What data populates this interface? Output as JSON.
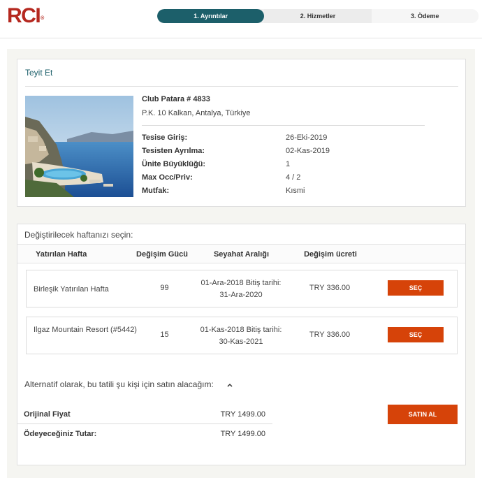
{
  "brand": {
    "logo": "RCI",
    "logo_mark": "®"
  },
  "steps": [
    {
      "label": "1. Ayrıntılar",
      "active": true
    },
    {
      "label": "2. Hizmetler",
      "active": false
    },
    {
      "label": "3. Ödeme",
      "active": false
    }
  ],
  "confirm": {
    "title": "Teyit Et",
    "resort_name": "Club Patara # 4833",
    "address": "P.K. 10 Kalkan,  Antalya,  Türkiye",
    "details": [
      {
        "label": "Tesise Giriş:",
        "value": "26-Eki-2019"
      },
      {
        "label": "Tesisten Ayrılma:",
        "value": "02-Kas-2019"
      },
      {
        "label": "Ünite Büyüklüğü:",
        "value": "1"
      },
      {
        "label": "Max Occ/Priv:",
        "value": "4 / 2"
      },
      {
        "label": "Mutfak:",
        "value": "Kısmi"
      }
    ]
  },
  "exchange": {
    "title": "Değiştirilecek haftanızı seçin:",
    "columns": [
      "Yatırılan Hafta",
      "Değişim Gücü",
      "Seyahat Aralığı",
      "Değişim ücreti"
    ],
    "rows": [
      {
        "name": "Birleşik Yatırılan Hafta",
        "power": "99",
        "range_line1": "01-Ara-2018 Bitiş tarihi:",
        "range_line2": "31-Ara-2020",
        "fee": "TRY 336.00",
        "button": "SEÇ"
      },
      {
        "name": "Ilgaz Mountain Resort (#5442)",
        "power": "15",
        "range_line1": "01-Kas-2018 Bitiş tarihi:",
        "range_line2": "30-Kas-2021",
        "fee": "TRY 336.00",
        "button": "SEÇ"
      }
    ],
    "alternative_text": "Alternatif olarak, bu tatili şu kişi için satın alacağım:",
    "original_price_label": "Orijinal Fiyat",
    "original_price_value": "TRY 1499.00",
    "pay_label": "Ödeyeceğiniz Tutar:",
    "pay_value": "TRY 1499.00",
    "buy_button": "SATIN AL"
  },
  "colors": {
    "brand_red": "#b5281f",
    "teal": "#1c5f6a",
    "button_orange": "#d64309"
  }
}
